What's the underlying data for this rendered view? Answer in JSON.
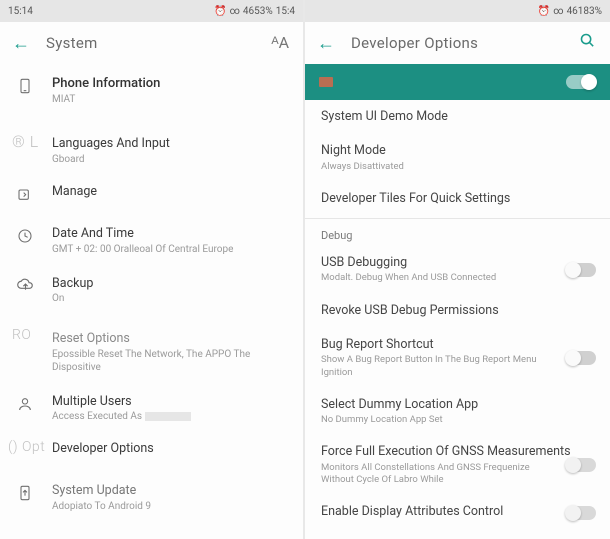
{
  "left": {
    "status": {
      "time": "15:14",
      "alarm": "⏰",
      "link": "∞",
      "battery": "4653%",
      "extra": "15:4"
    },
    "appbar": {
      "title": "System",
      "action": "ᴬA"
    },
    "ghosts": {
      "reg": "® L",
      "ro": "RO",
      "opt": "() Opt"
    },
    "items": {
      "phone": {
        "title": "Phone Information",
        "sub": "MIAT"
      },
      "lang": {
        "title": "Languages And Input",
        "sub": "Gboard"
      },
      "manage": {
        "title": "Manage"
      },
      "date": {
        "title": "Date And Time",
        "sub": "GMT + 02: 00 Oralleoal Of Central Europe"
      },
      "backup": {
        "title": "Backup",
        "sub": "On"
      },
      "reset": {
        "title": "Reset Options",
        "sub": "Epossible Reset The Network, The APPO The Dispositive"
      },
      "users": {
        "title": "Multiple Users",
        "sub": "Access Executed As"
      },
      "dev": {
        "title": "Developer Options"
      },
      "update": {
        "title": "System Update",
        "sub": "Adopiato To Android 9"
      }
    }
  },
  "right": {
    "status": {
      "time": " ",
      "alarm": "⏰",
      "link": "∞",
      "battery": "46183%"
    },
    "appbar": {
      "title": "Developer Options"
    },
    "sections": {
      "debug": "Debug"
    },
    "items": {
      "demo": {
        "title": "System UI Demo Mode"
      },
      "night": {
        "title": "Night Mode",
        "sub": "Always Disattivated"
      },
      "tiles": {
        "title": "Developer Tiles For Quick Settings"
      },
      "usb": {
        "title": "USB Debugging",
        "sub": "Modalt. Debug When And USB Connected"
      },
      "revoke": {
        "title": "Revoke USB Debug Permissions"
      },
      "bug": {
        "title": "Bug Report Shortcut",
        "sub": "Show A Bug Report Button In The Bug Report Menu Ignition"
      },
      "dummy": {
        "title": "Select Dummy Location App",
        "sub": "No Dummy Location App Set"
      },
      "gnss": {
        "title": "Force Full Execution Of GNSS Measurements",
        "sub": "Monitors All Constellations And GNSS Frequenize Without Cycle Of Labro While"
      },
      "attrs": {
        "title": "Enable Display Attributes Control"
      }
    }
  }
}
